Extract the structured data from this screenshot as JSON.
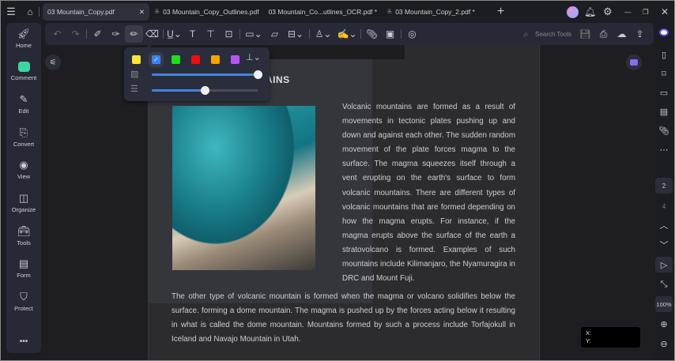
{
  "tabs": [
    {
      "label": "03 Mountain_Copy.pdf",
      "active": true
    },
    {
      "label": "03 Mountain_Copy_Outlines.pdf",
      "active": false
    },
    {
      "label": "03 Mountain_Co...utlines_OCR.pdf *",
      "active": false
    },
    {
      "label": "03 Mountain_Copy_2.pdf *",
      "active": false
    }
  ],
  "sidebar": {
    "items": [
      {
        "label": "Home",
        "icon": "rocket-icon"
      },
      {
        "label": "Comment",
        "icon": "comment-icon"
      },
      {
        "label": "Edit",
        "icon": "edit-icon"
      },
      {
        "label": "Convert",
        "icon": "convert-icon"
      },
      {
        "label": "View",
        "icon": "view-icon"
      },
      {
        "label": "Organize",
        "icon": "organize-icon"
      },
      {
        "label": "Tools",
        "icon": "tools-icon"
      },
      {
        "label": "Form",
        "icon": "form-icon"
      },
      {
        "label": "Protect",
        "icon": "protect-icon"
      }
    ],
    "more": "•••"
  },
  "toolbar": {
    "search_placeholder": "Search Tools"
  },
  "popup": {
    "colors": [
      "#f5e43a",
      "#3b82f6",
      "#1fdc1f",
      "#e81010",
      "#f5a200",
      "#b455f0"
    ],
    "selected_color": "#3b82f6",
    "opacity_percent": 100,
    "thickness_percent": 50
  },
  "document": {
    "heading": "AINS",
    "col_text": "Volcanic mountains are formed as a result of movements in tectonic plates pushing up and down and against each other. The sudden random movement of the plate forces magma to the surface. The magma squeezes itself through a vent erupting on the earth's surface to form volcanic mountains. There are different types of volcanic mountains that are formed depending on how the magma erupts. For instance, if the magma erupts above the surface of the earth a stratovolcano is formed. Examples of such mountains include Kilimanjaro, the Nyamuragira in DRC and Mount Fuji.",
    "full_text": "The other type of volcanic mountain is formed when the magma or volcano solidifies below the surface. forming a dome mountain. The magma is pushed up by the forces acting below it resulting in what is called the dome mountain. Mountains formed by such a process include Torfajokull in Iceland and Navajo Mountain in Utah."
  },
  "right_panel": {
    "page_current": "2",
    "page_total": "4",
    "zoom": "100%"
  },
  "coords": {
    "x_label": "X:",
    "y_label": "Y:"
  }
}
